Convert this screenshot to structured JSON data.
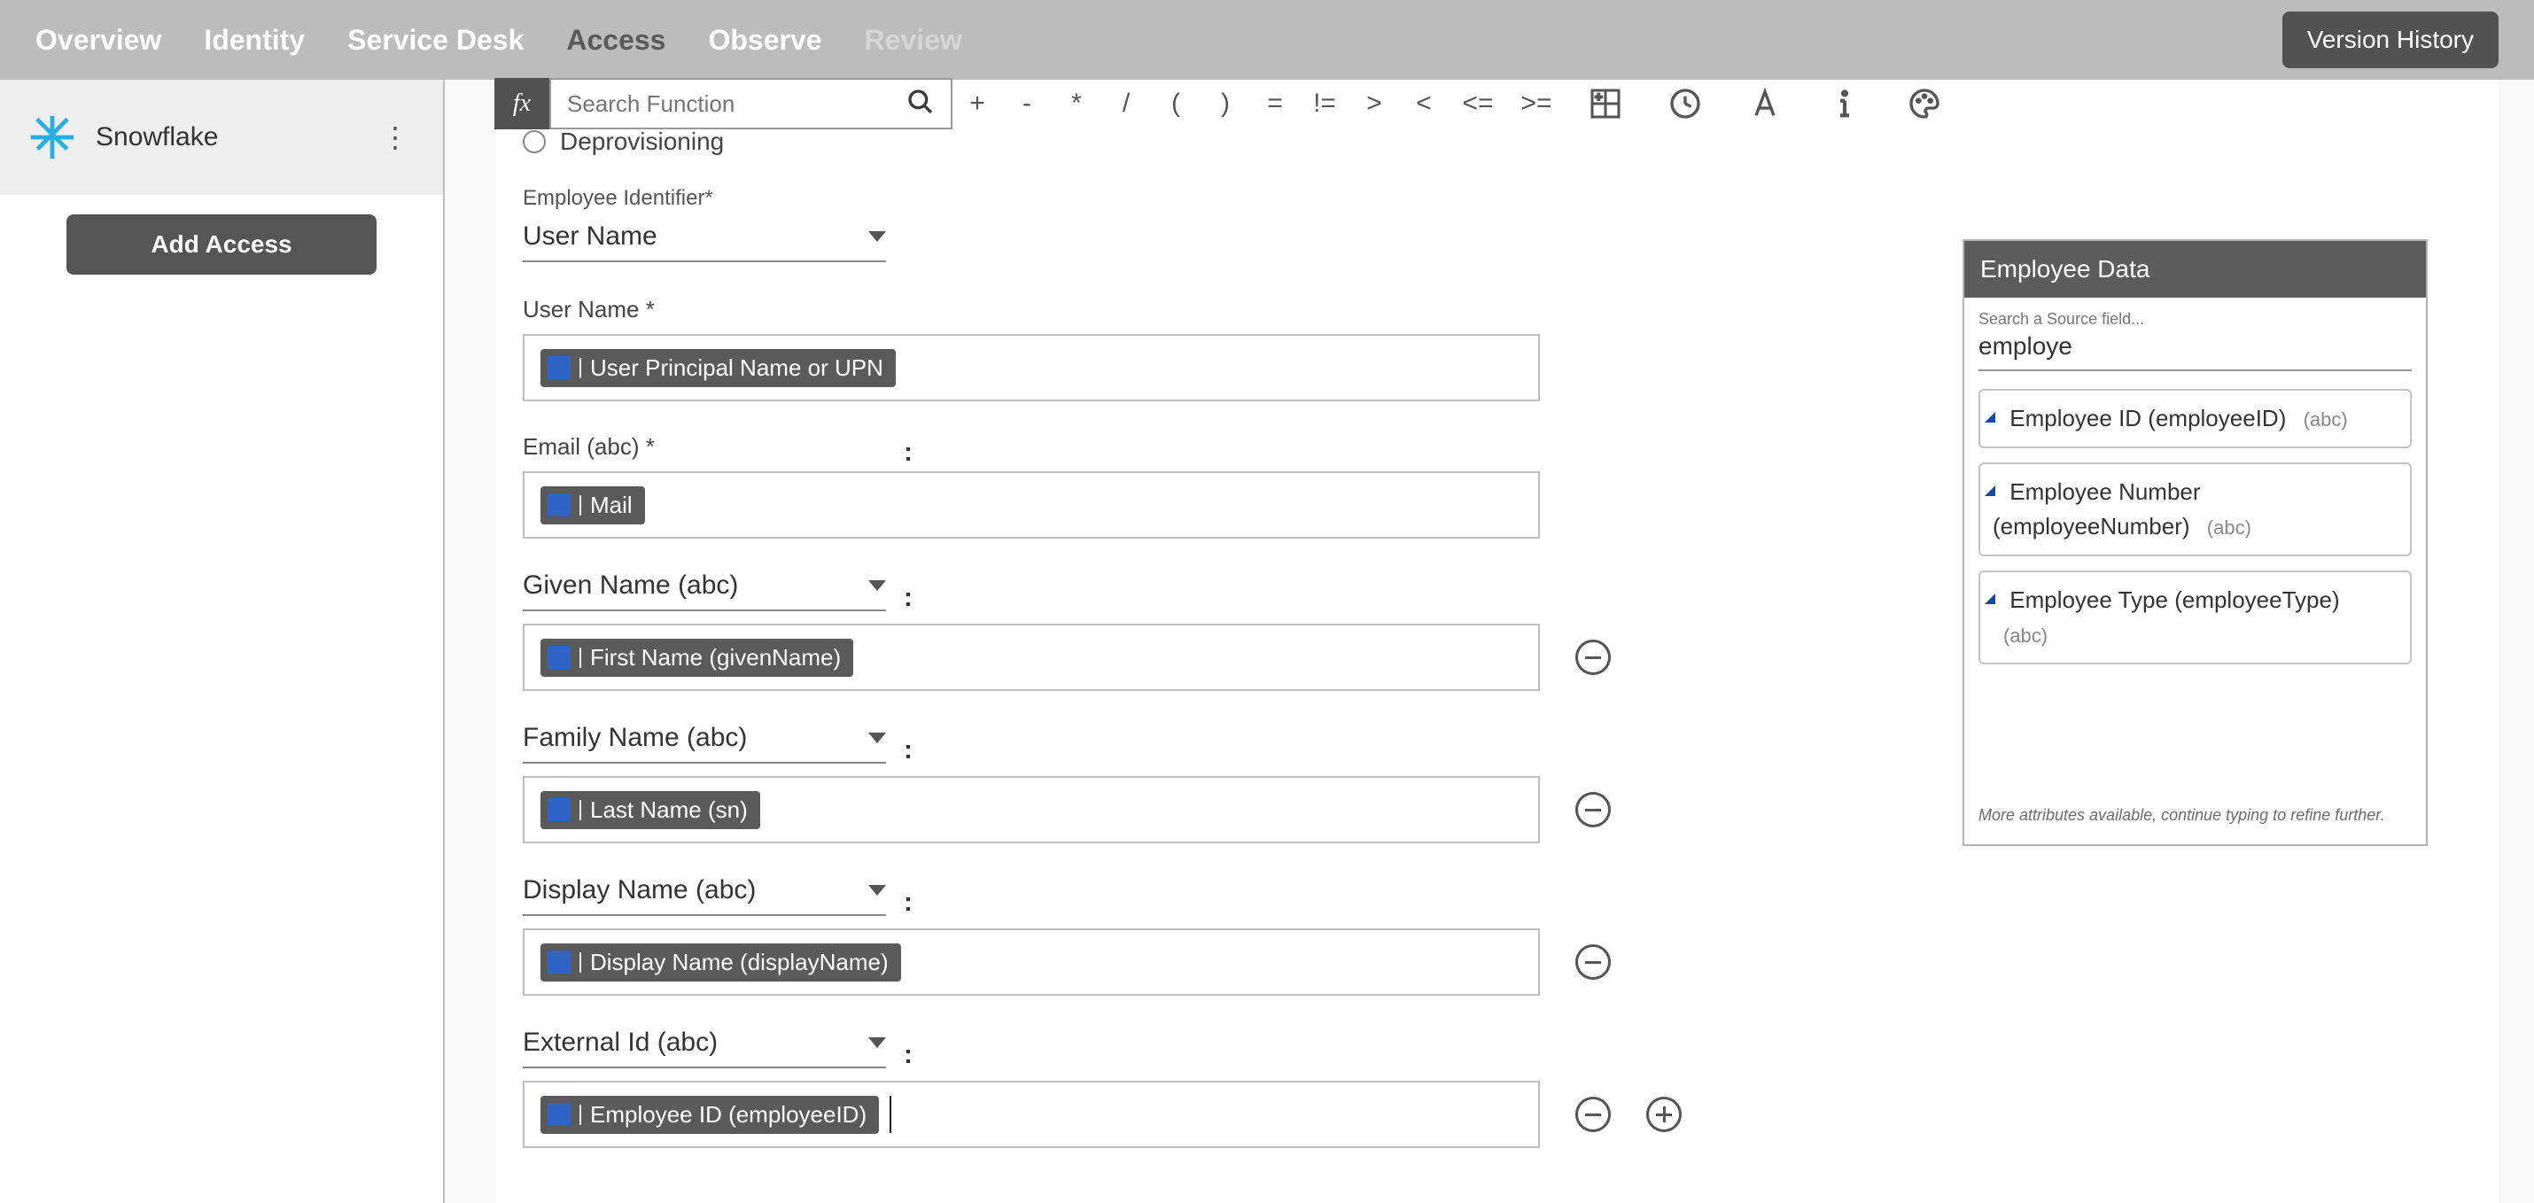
{
  "nav": {
    "tabs": [
      "Overview",
      "Identity",
      "Service Desk",
      "Access",
      "Observe",
      "Review"
    ],
    "active": "Access",
    "version_history": "Version History"
  },
  "sidebar": {
    "app_name": "Snowflake",
    "add_access": "Add Access"
  },
  "formula": {
    "search_placeholder": "Search Function",
    "ops": [
      "+",
      "-",
      "*",
      "/",
      "(",
      ")",
      "=",
      "!=",
      ">",
      "<",
      "<=",
      ">="
    ]
  },
  "section_row": "Deprovisioning",
  "emp_id_label": "Employee Identifier*",
  "emp_id_value": "User Name",
  "fields": {
    "user_name": {
      "label": "User Name *",
      "chip": "User Principal Name or UPN"
    },
    "email": {
      "label": "Email (abc) *",
      "chip": "Mail",
      "colon": ":"
    },
    "given": {
      "select": "Given Name (abc)",
      "colon": ":",
      "chip": "First Name (givenName)"
    },
    "family": {
      "select": "Family Name (abc)",
      "colon": ":",
      "chip": "Last Name (sn)"
    },
    "display": {
      "select": "Display Name (abc)",
      "colon": ":",
      "chip": "Display Name (displayName)"
    },
    "external": {
      "select": "External Id (abc)",
      "colon": ":",
      "chip": "Employee ID (employeeID)"
    }
  },
  "panel": {
    "title": "Employee Data",
    "sub": "Search a Source field...",
    "query": "employe",
    "results": [
      {
        "label": "Employee ID (employeeID)",
        "type": "(abc)"
      },
      {
        "label": "Employee Number (employeeNumber)",
        "type": "(abc)"
      },
      {
        "label": "Employee Type (employeeType)",
        "type": "(abc)"
      }
    ],
    "footer": "More attributes available, continue typing to refine further."
  }
}
